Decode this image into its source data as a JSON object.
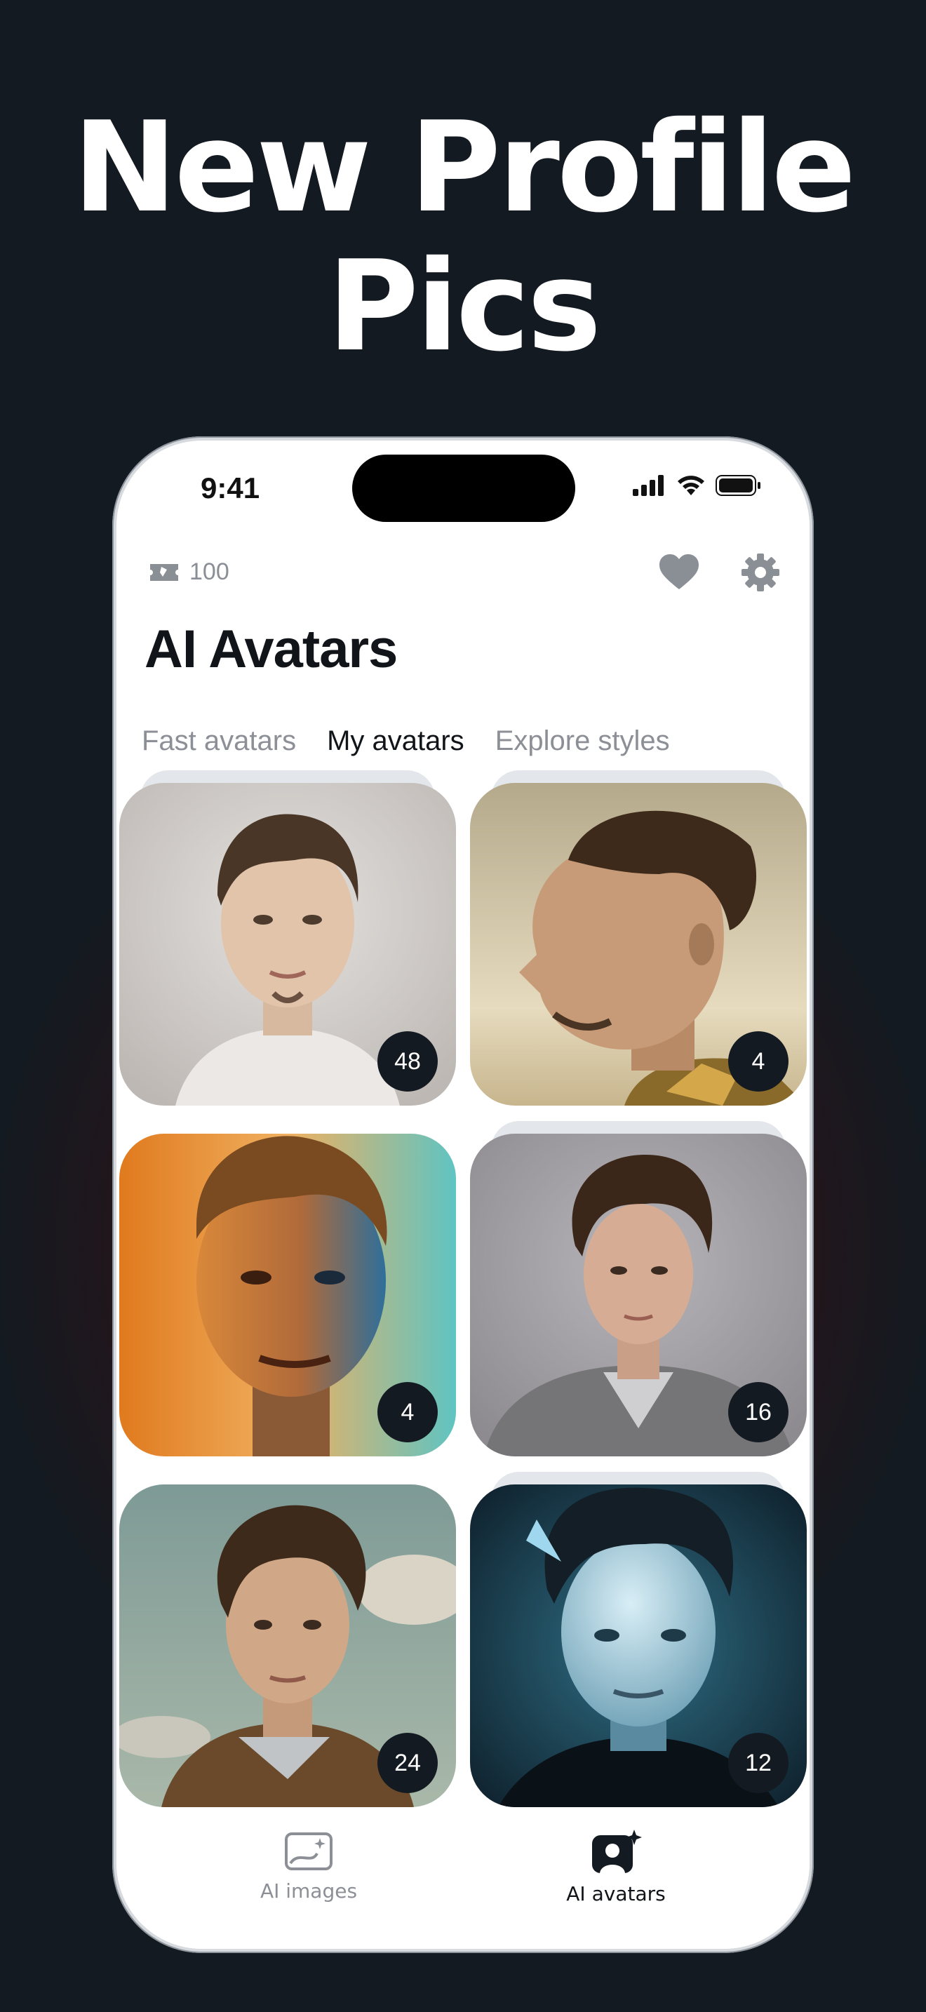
{
  "promo": {
    "line1": "New Profile",
    "line2": "Pics"
  },
  "status_bar": {
    "time": "9:41"
  },
  "header": {
    "coins": "100",
    "title": "AI Avatars"
  },
  "tabs": [
    {
      "label": "Fast avatars",
      "active": false
    },
    {
      "label": "My avatars",
      "active": true
    },
    {
      "label": "Explore styles",
      "active": false
    }
  ],
  "avatars": [
    {
      "count": "48",
      "style": "watercolor-sketch"
    },
    {
      "count": "4",
      "style": "renaissance-profile"
    },
    {
      "count": "4",
      "style": "fire-and-ice"
    },
    {
      "count": "16",
      "style": "studio-photo"
    },
    {
      "count": "24",
      "style": "oil-painting-sky"
    },
    {
      "count": "12",
      "style": "cyber-glow"
    }
  ],
  "bottom_nav": [
    {
      "label": "AI images",
      "icon": "image-sparkle-icon",
      "active": false
    },
    {
      "label": "AI avatars",
      "icon": "avatar-sparkle-icon",
      "active": true
    }
  ],
  "colors": {
    "background": "#141a21",
    "accent_glow": "#4a1419",
    "badge": "#141a21",
    "inactive_text": "#8c9096"
  }
}
